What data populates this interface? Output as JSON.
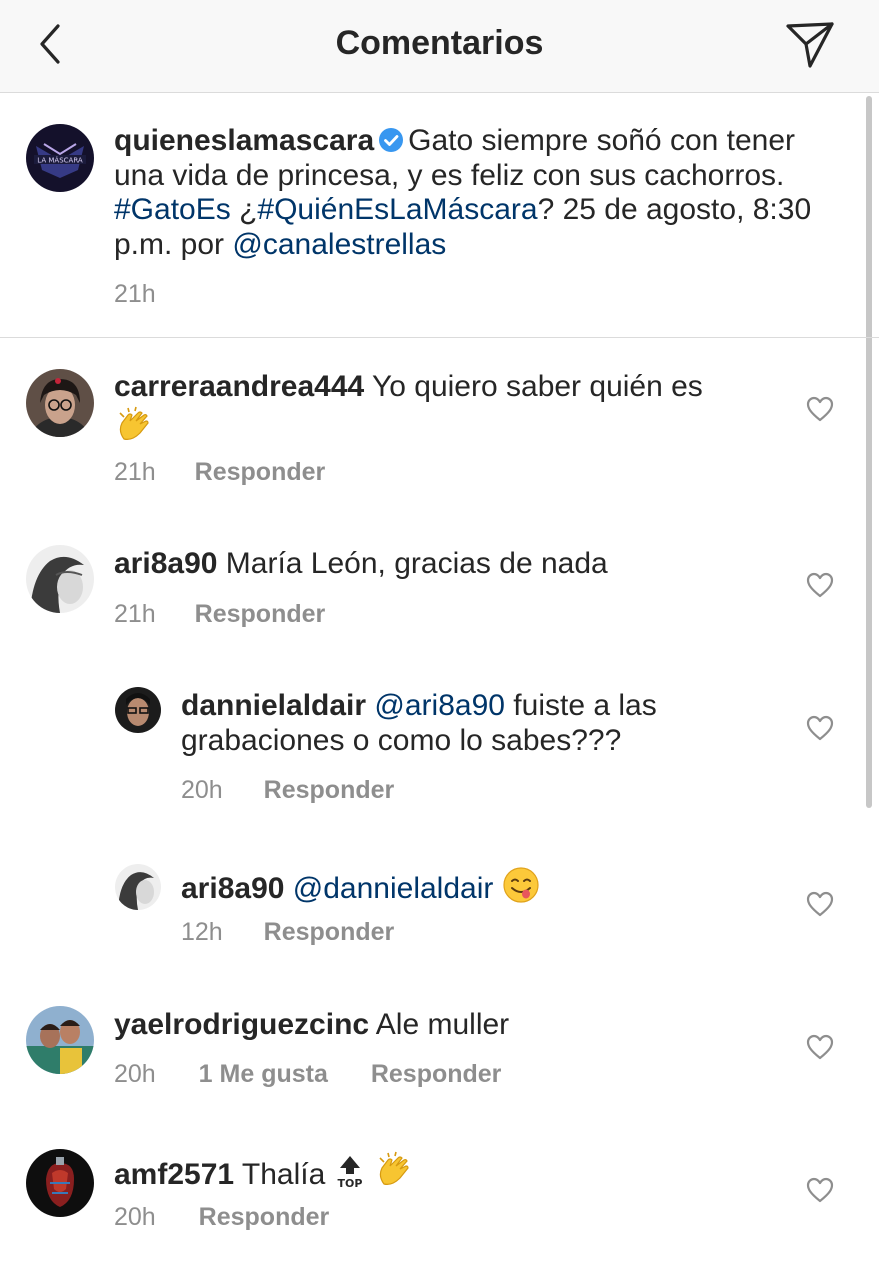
{
  "header": {
    "title": "Comentarios",
    "back_icon": "chevron-left-icon",
    "send_icon": "paper-plane-icon"
  },
  "caption": {
    "username": "quieneslamascara",
    "text_1": "Gato siempre soñó con tener una vida de princesa, y es feliz con sus cachorros.",
    "hashtag_1": "#GatoEs",
    "text_2": "¿",
    "hashtag_2": "#QuiénEsLaMáscara",
    "text_3": "? 25 de agosto, 8:30 p.m. por",
    "mention": "@canalestrellas",
    "time": "21h",
    "avatar_text": "LA MÁSCARA"
  },
  "comments": [
    {
      "username": "carreraandrea444",
      "text": "Yo quiero saber quién es",
      "emoji": "clapping-hands-emoji",
      "time": "21h",
      "reply_label": "Responder"
    },
    {
      "username": "ari8a90",
      "text": "María León, gracias de nada",
      "time": "21h",
      "reply_label": "Responder"
    },
    {
      "username": "dannielaldair",
      "mention": "@ari8a90",
      "text": "fuiste a las grabaciones o como lo sabes???",
      "time": "20h",
      "reply_label": "Responder"
    },
    {
      "username": "ari8a90",
      "mention": "@dannielaldair",
      "emoji": "face-savoring-food-emoji",
      "time": "12h",
      "reply_label": "Responder"
    },
    {
      "username": "yaelrodriguezcinc",
      "text": "Ale muller",
      "time": "20h",
      "likes_label": "1 Me gusta",
      "reply_label": "Responder"
    },
    {
      "username": "amf2571",
      "text": "Thalía",
      "emoji": "top-arrow-emoji",
      "emoji_2": "clapping-hands-emoji",
      "time": "20h",
      "reply_label": "Responder"
    }
  ],
  "colors": {
    "text": "#262626",
    "secondary": "#8e8e8e",
    "link": "#003569",
    "verified": "#3897f0",
    "divider": "#dbdbdb",
    "header_bg": "#f8f8f8"
  }
}
